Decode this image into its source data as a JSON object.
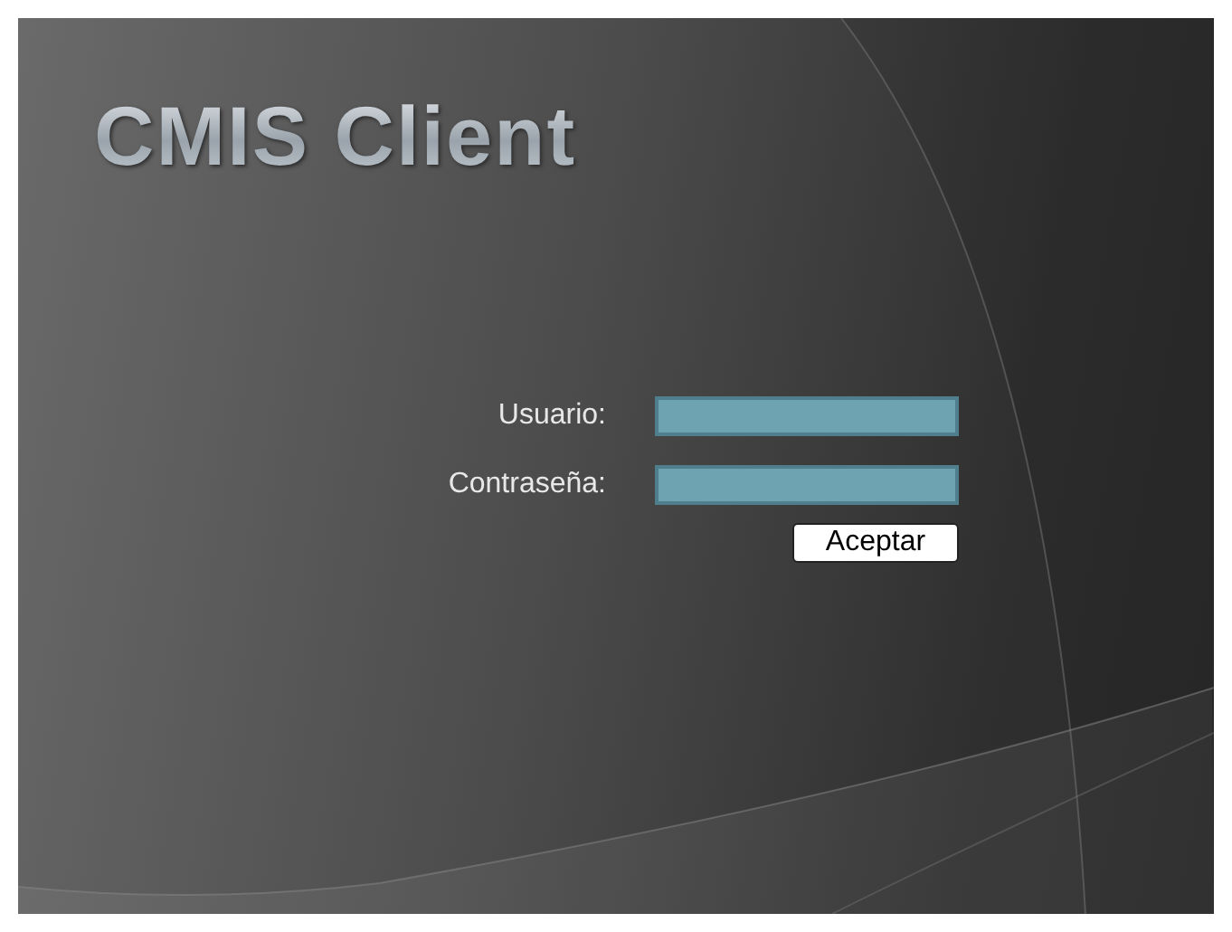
{
  "title": "CMIS Client",
  "fields": [
    {
      "label": "Usuario:"
    },
    {
      "label": "Contraseña:"
    }
  ],
  "buttons": [
    "Aceptar"
  ]
}
